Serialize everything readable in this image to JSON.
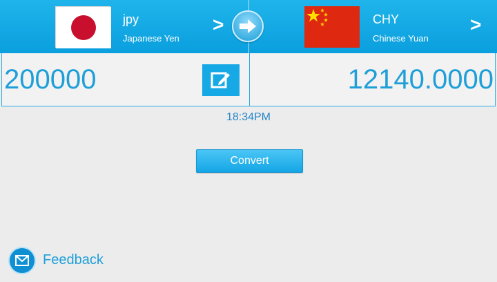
{
  "from": {
    "code": "jpy",
    "name": "Japanese Yen",
    "flag_icon": "japan-flag-icon"
  },
  "to": {
    "code": "CHY",
    "name": "Chinese Yuan",
    "flag_icon": "china-flag-icon"
  },
  "chevron": ">",
  "amount_input": "200000",
  "amount_output": "12140.0000",
  "time": "18:34PM",
  "convert_label": "Convert",
  "feedback_label": "Feedback",
  "colors": {
    "accent": "#1fa8e6",
    "header": "#0ea3e0",
    "background": "#ececec"
  }
}
